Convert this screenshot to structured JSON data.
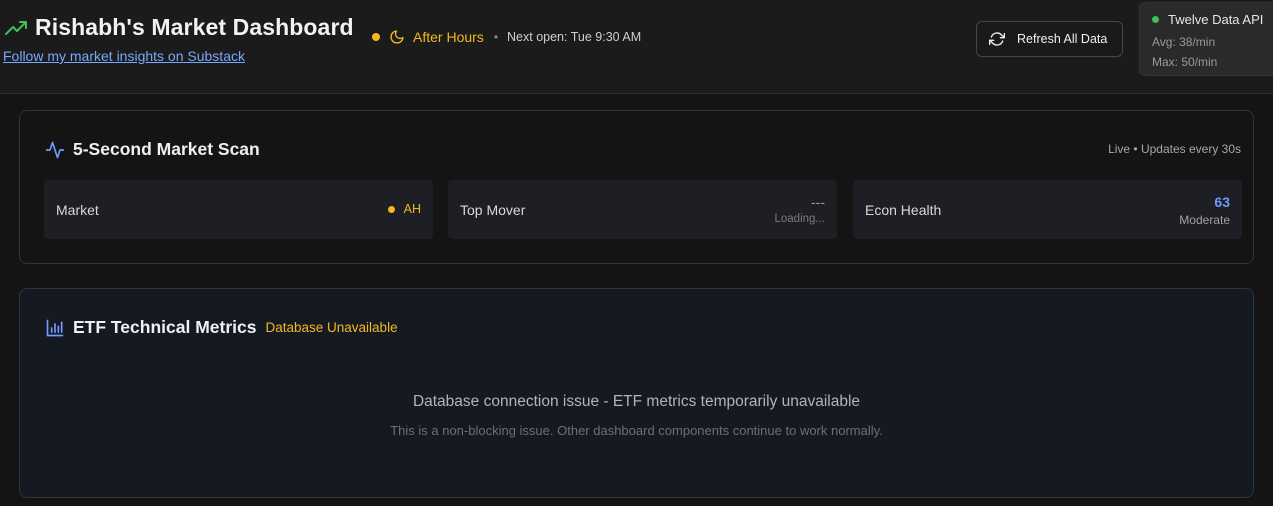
{
  "header": {
    "title": "Rishabh's Market Dashboard",
    "substack_link": "Follow my market insights on Substack",
    "market_status": "After Hours",
    "separator": "•",
    "next_open": "Next open: Tue 9:30 AM",
    "refresh_label": "Refresh All Data",
    "icons": {
      "trend": "trending-up-icon",
      "moon": "moon-icon",
      "refresh": "refresh-icon"
    },
    "colors": {
      "trend": "#3fbf5a",
      "status": "#f2b81f",
      "link": "#7aa7ff"
    }
  },
  "api": {
    "name": "Twelve Data API",
    "status_color": "#3fbf5a",
    "avg": "Avg: 38/min",
    "max": "Max: 50/min"
  },
  "scan": {
    "title": "5-Second Market Scan",
    "live_text": "Live • Updates every 30s",
    "icon": "activity-icon",
    "tiles": [
      {
        "label": "Market",
        "value": "AH"
      },
      {
        "label": "Top Mover",
        "value": "---",
        "sub": "Loading..."
      },
      {
        "label": "Econ Health",
        "value": "63",
        "sub": "Moderate"
      }
    ]
  },
  "etf": {
    "title": "ETF Technical Metrics",
    "badge": "Database Unavailable",
    "icon": "bar-chart-icon",
    "message": "Database connection issue - ETF metrics temporarily unavailable",
    "sub_message": "This is a non-blocking issue. Other dashboard components continue to work normally."
  }
}
